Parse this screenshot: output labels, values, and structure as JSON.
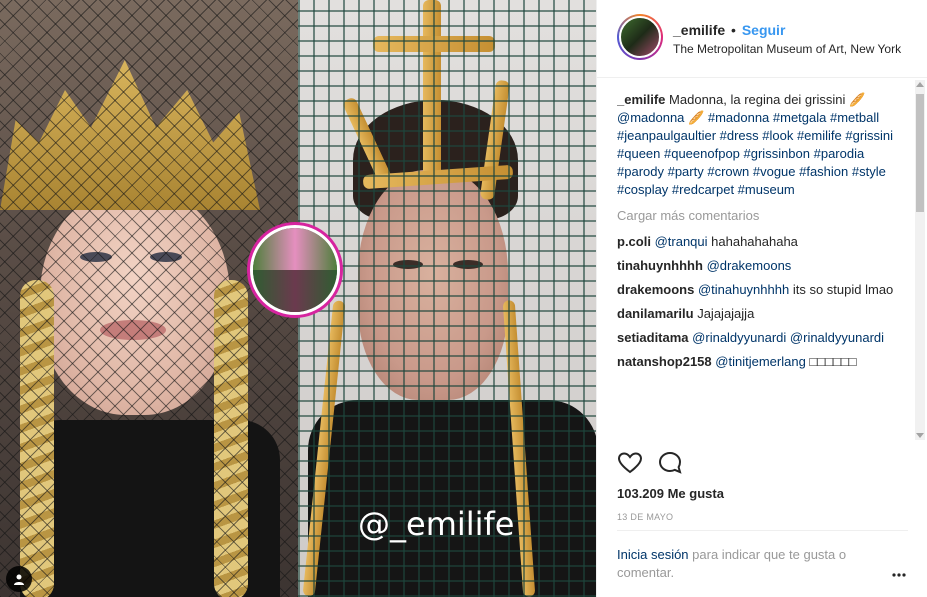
{
  "header": {
    "username": "_emilife",
    "separator": "•",
    "follow_label": "Seguir",
    "location": "The Metropolitan Museum of Art, New York"
  },
  "media": {
    "watermark": "@_emilife"
  },
  "caption": {
    "username": "_emilife",
    "text": "Madonna, la regina dei grissini 🥖",
    "mention": "@madonna",
    "mention_suffix": "🥖",
    "hashtags": "#madonna #metgala #metball #jeanpaulgaultier #dress #look #emilife #grissini #queen #queenofpop #grissinbon #parodia #parody #party #crown #vogue #fashion #style #cosplay #redcarpet #museum"
  },
  "load_more": "Cargar más comentarios",
  "comments": [
    {
      "user": "p.coli",
      "text": "hahahahahaha",
      "mention": "@tranqui"
    },
    {
      "user": "tinahuynhhhh",
      "text": "",
      "mention": "@drakemoons"
    },
    {
      "user": "drakemoons",
      "text": "its so stupid lmao",
      "mention": "@tinahuynhhhh"
    },
    {
      "user": "danilamarilu",
      "text": "Jajajajajja",
      "mention": ""
    },
    {
      "user": "setiaditama",
      "text": "",
      "mention": "@rinaldyyunardi @rinaldyyunardi"
    },
    {
      "user": "natanshop2158",
      "text": "□□□□□□",
      "mention": "@tinitjemerlang"
    }
  ],
  "stats": {
    "likes": "103.209 Me gusta",
    "date": "13 DE MAYO"
  },
  "login_prompt": {
    "link": "Inicia sesión",
    "text": "para indicar que te gusta o comentar."
  },
  "icons": {
    "like": "heart-icon",
    "comment": "comment-icon",
    "more": "more-options-icon",
    "tag": "user-tag-icon"
  },
  "colors": {
    "link": "#003569",
    "follow": "#3897f0",
    "muted": "#999999",
    "ring": "#d6249f"
  }
}
